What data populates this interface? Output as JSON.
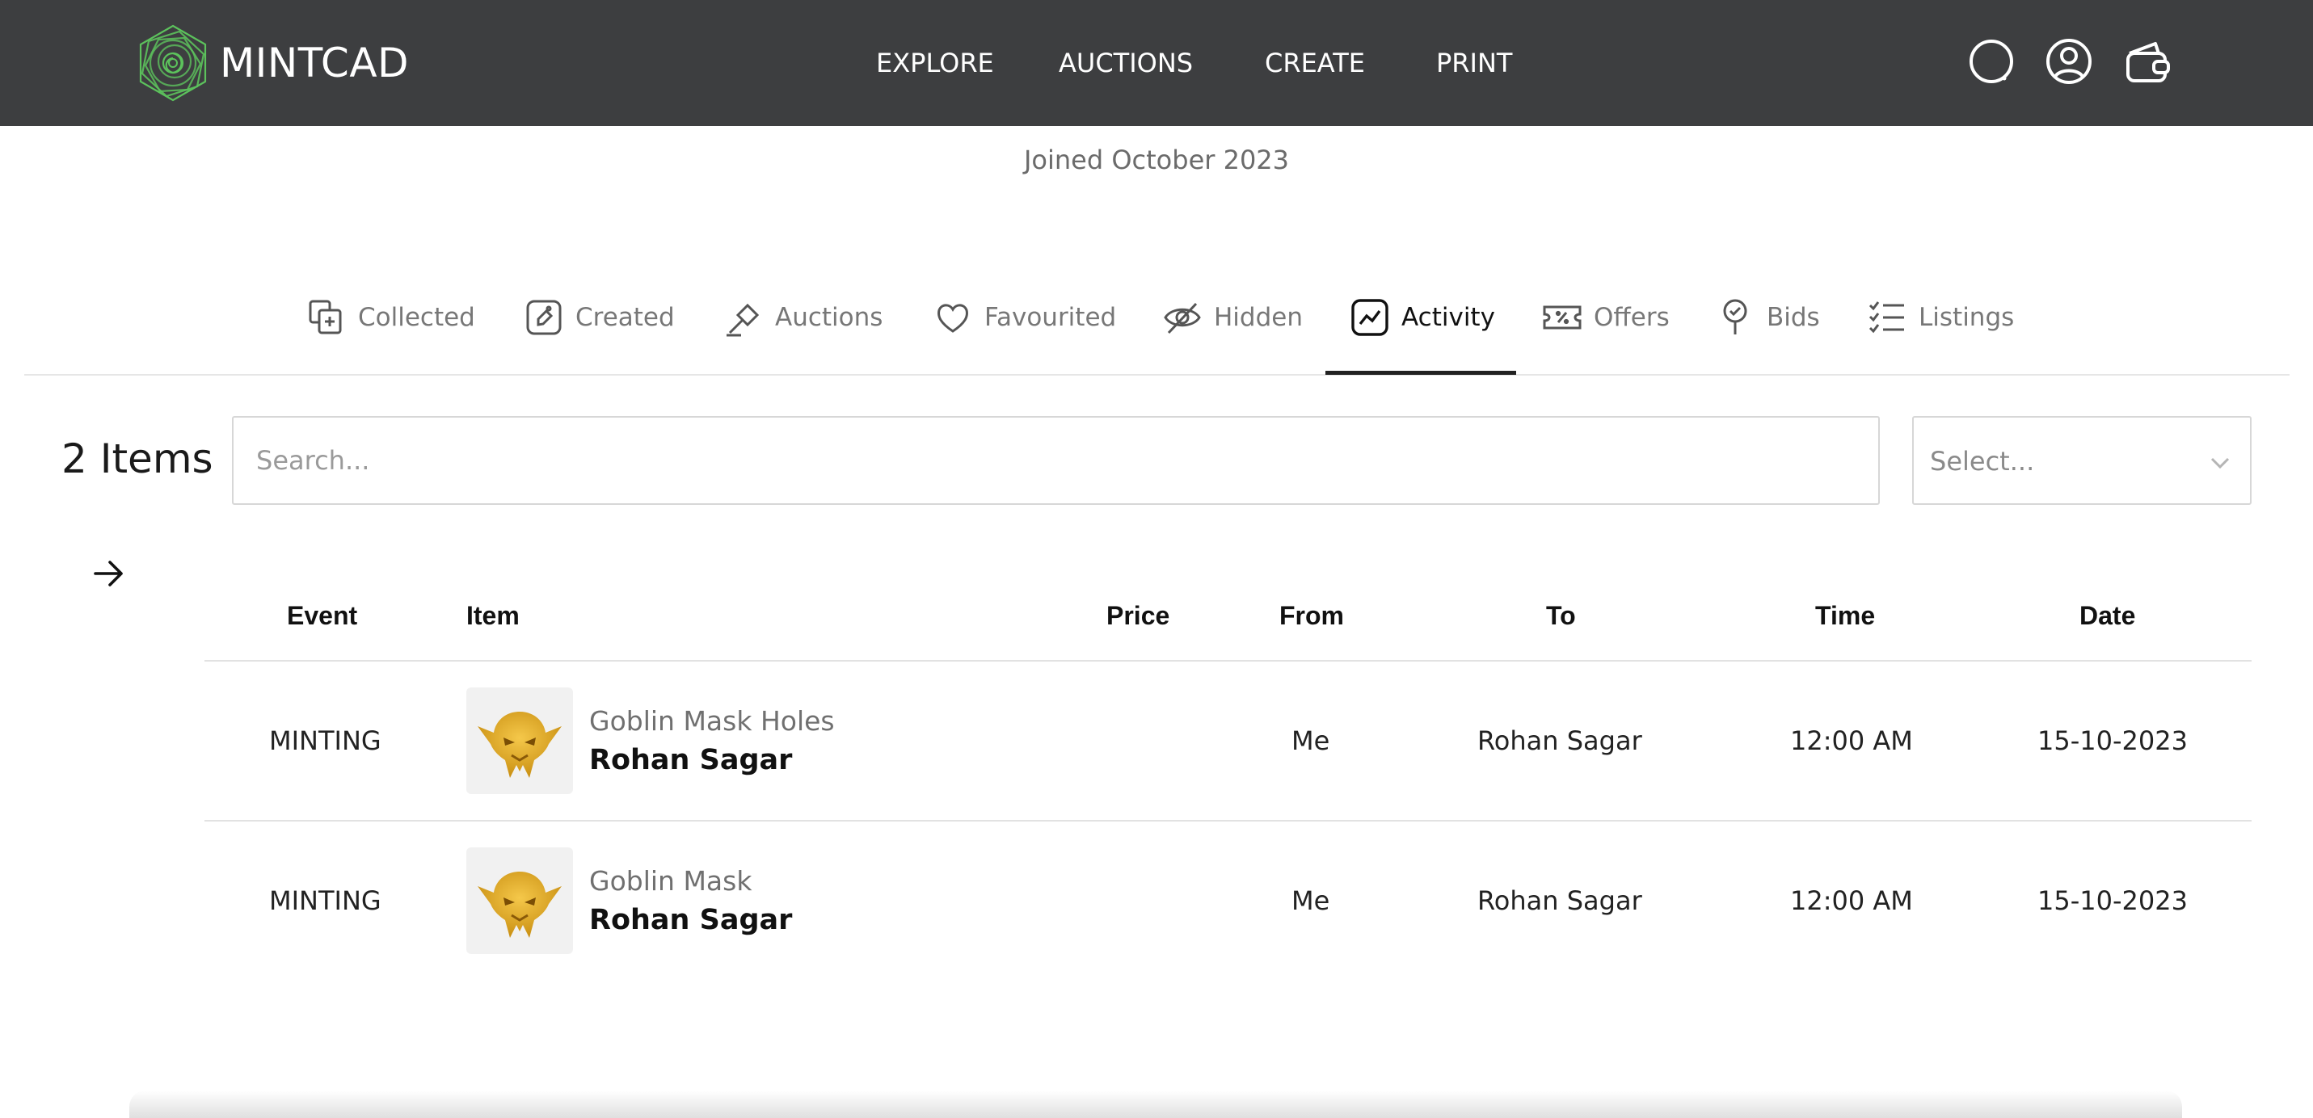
{
  "brand": {
    "name": "MINTCAD",
    "logo_icon": "spiral-hexagon-logo",
    "accent": "#4caf50"
  },
  "header": {
    "nav": [
      "EXPLORE",
      "AUCTIONS",
      "CREATE",
      "PRINT"
    ],
    "icons": [
      "search-icon",
      "user-icon",
      "wallet-icon"
    ],
    "background": "#3d3e40"
  },
  "profile": {
    "joined": "Joined October 2023"
  },
  "tabs": [
    {
      "label": "Collected",
      "icon": "collected-icon",
      "active": false
    },
    {
      "label": "Created",
      "icon": "created-icon",
      "active": false
    },
    {
      "label": "Auctions",
      "icon": "gavel-icon",
      "active": false
    },
    {
      "label": "Favourited",
      "icon": "heart-icon",
      "active": false
    },
    {
      "label": "Hidden",
      "icon": "eye-off-icon",
      "active": false
    },
    {
      "label": "Activity",
      "icon": "activity-icon",
      "active": true
    },
    {
      "label": "Offers",
      "icon": "ticket-icon",
      "active": false
    },
    {
      "label": "Bids",
      "icon": "bid-icon",
      "active": false
    },
    {
      "label": "Listings",
      "icon": "checklist-icon",
      "active": false
    }
  ],
  "toolbar": {
    "count_label": "2 Items",
    "search_placeholder": "Search...",
    "select_placeholder": "Select..."
  },
  "table": {
    "columns": [
      "Event",
      "Item",
      "Price",
      "From",
      "To",
      "Time",
      "Date"
    ],
    "rows": [
      {
        "event": "MINTING",
        "item_name": "Goblin Mask Holes",
        "item_owner": "Rohan Sagar",
        "price": "",
        "from": "Me",
        "to": "Rohan Sagar",
        "time": "12:00 AM",
        "date": "15-10-2023",
        "thumb_icon": "goblin-mask-icon"
      },
      {
        "event": "MINTING",
        "item_name": "Goblin Mask",
        "item_owner": "Rohan Sagar",
        "price": "",
        "from": "Me",
        "to": "Rohan Sagar",
        "time": "12:00 AM",
        "date": "15-10-2023",
        "thumb_icon": "goblin-mask-icon"
      }
    ]
  }
}
